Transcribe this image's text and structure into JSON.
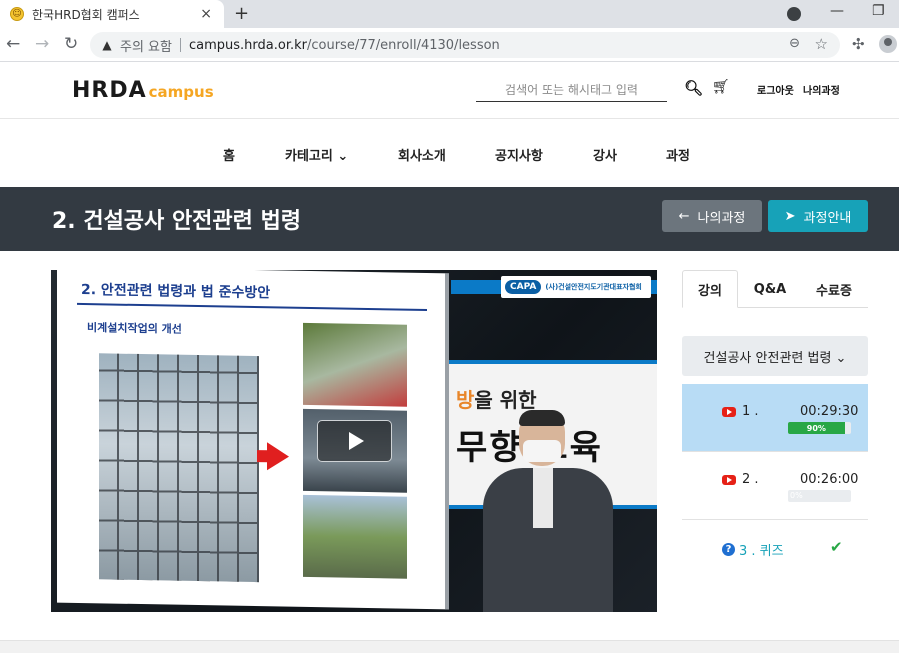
{
  "browser": {
    "tab_title": "한국HRD협회 캠퍼스",
    "tab_close": "×",
    "new_tab": "+",
    "security_warning": "주의 요함",
    "url_host": "campus.hrda.or.kr",
    "url_path": "/course/77/enroll/4130/lesson"
  },
  "header": {
    "logo_main": "HRDA",
    "logo_sub": "campus",
    "search_placeholder": "검색어 또는 해시태그 입력",
    "logout": "로그아웃",
    "my_courses": "나의과정"
  },
  "nav": {
    "items": [
      "홈",
      "카테고리 ⌄",
      "회사소개",
      "공지사항",
      "강사",
      "과정"
    ]
  },
  "title_bar": {
    "title": "2. 건설공사 안전관련 법령",
    "my_course_button": "나의과정",
    "guide_button": "과정안내"
  },
  "video": {
    "slide_title": "2. 안전관련 법령과 법 준수방안",
    "slide_subtitle": "비계설치작업의 개선",
    "badge_logo": "CAPA",
    "badge_text": "(사)건설안전지도기관대표자협회",
    "studio_line1_orange": "방",
    "studio_line1_rest": "을 위한",
    "studio_line2": "무향 교육"
  },
  "sidebar": {
    "tabs": [
      "강의",
      "Q&A",
      "수료증"
    ],
    "course_select": "건설공사 안전관련 법령 ⌄",
    "lessons": [
      {
        "label": "1 .",
        "time": "00:29:30",
        "progress": 90,
        "progress_label": "90%"
      },
      {
        "label": "2 .",
        "time": "00:26:00",
        "progress": 0,
        "progress_label": "0%"
      }
    ],
    "quiz": {
      "label": "3 . 퀴즈"
    }
  },
  "colors": {
    "title_bar_bg": "#333a42",
    "guide_button": "#17a2b8",
    "my_course_button": "#6c757d",
    "active_lesson": "#b8dcf5",
    "progress": "#28a745",
    "logo_accent": "#f5a623"
  }
}
